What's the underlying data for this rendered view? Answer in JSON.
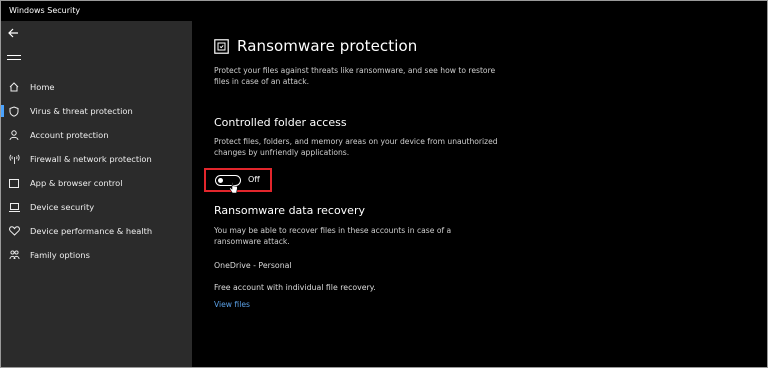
{
  "window": {
    "title": "Windows Security"
  },
  "sidebar": {
    "back_icon": "back-arrow-icon",
    "menu_icon": "hamburger-menu-icon",
    "items": [
      {
        "label": "Home",
        "icon": "home-icon"
      },
      {
        "label": "Virus & threat protection",
        "icon": "shield-icon",
        "active": true
      },
      {
        "label": "Account protection",
        "icon": "person-icon"
      },
      {
        "label": "Firewall & network protection",
        "icon": "wifi-antenna-icon"
      },
      {
        "label": "App & browser control",
        "icon": "app-window-icon"
      },
      {
        "label": "Device security",
        "icon": "laptop-icon"
      },
      {
        "label": "Device performance & health",
        "icon": "heart-icon"
      },
      {
        "label": "Family options",
        "icon": "family-icon"
      }
    ],
    "accent_color": "#4aa3ff",
    "background": "#2b2b2b"
  },
  "main": {
    "title": "Ransomware protection",
    "title_icon": "ransomware-protection-icon",
    "intro_line1": "Protect your files against threats like ransomware, and see how to restore",
    "intro_line2": "files in case of an attack.",
    "cfa": {
      "title": "Controlled folder access",
      "desc_line1": "Protect files, folders, and memory areas on your device from unauthorized",
      "desc_line2": "changes by unfriendly applications.",
      "toggle_state": "Off",
      "highlight_color": "#e3262c"
    },
    "recovery": {
      "title": "Ransomware data recovery",
      "desc_line1": "You may be able to recover files in these accounts in case of a",
      "desc_line2": "ransomware attack.",
      "account_name": "OneDrive - Personal",
      "account_desc": "Free account with individual file recovery.",
      "link_label": "View files",
      "link_color": "#5aa0e6"
    }
  }
}
